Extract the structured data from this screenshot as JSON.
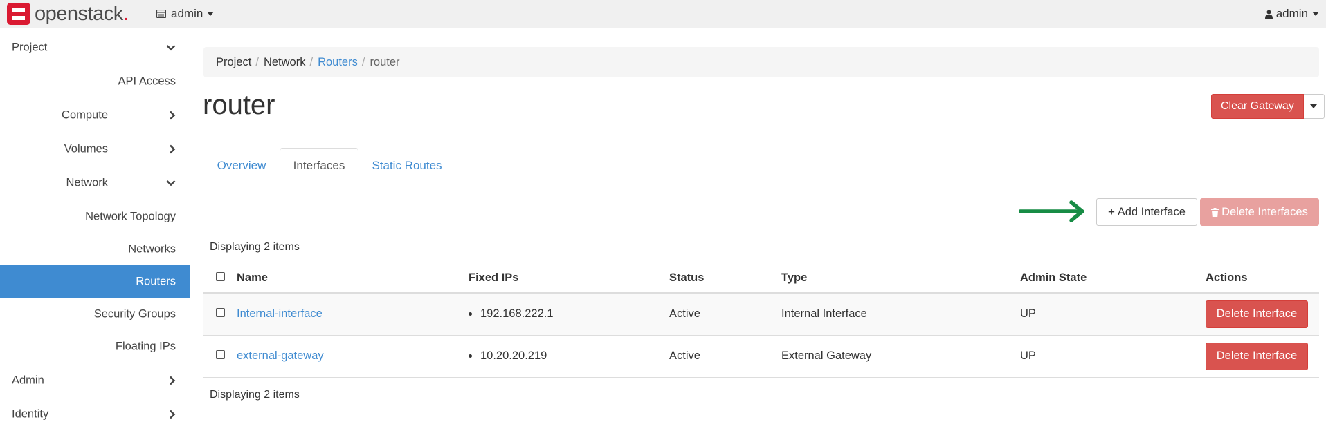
{
  "navbar": {
    "logo_text": "openstack",
    "logo_dot": ".",
    "project": "admin",
    "user": "admin"
  },
  "sidebar": {
    "items": [
      {
        "label": "Project",
        "level": 0,
        "chevron": "down"
      },
      {
        "label": "API Access",
        "level": 2,
        "chevron": ""
      },
      {
        "label": "Compute",
        "level": 1,
        "chevron": "right"
      },
      {
        "label": "Volumes",
        "level": 1,
        "chevron": "right"
      },
      {
        "label": "Network",
        "level": 1,
        "chevron": "down"
      },
      {
        "label": "Network Topology",
        "level": 2,
        "chevron": ""
      },
      {
        "label": "Networks",
        "level": 2,
        "chevron": ""
      },
      {
        "label": "Routers",
        "level": 2,
        "chevron": "",
        "active": true
      },
      {
        "label": "Security Groups",
        "level": 2,
        "chevron": ""
      },
      {
        "label": "Floating IPs",
        "level": 2,
        "chevron": ""
      },
      {
        "label": "Admin",
        "level": 0,
        "chevron": "right"
      },
      {
        "label": "Identity",
        "level": 0,
        "chevron": "right"
      }
    ]
  },
  "breadcrumb": {
    "items": [
      "Project",
      "Network",
      "Routers",
      "router"
    ],
    "separator": "/"
  },
  "page": {
    "title": "router",
    "clear_gateway_label": "Clear Gateway"
  },
  "tabs": [
    {
      "label": "Overview",
      "active": false
    },
    {
      "label": "Interfaces",
      "active": true
    },
    {
      "label": "Static Routes",
      "active": false
    }
  ],
  "actions": {
    "add_interface": "Add Interface",
    "add_interface_icon": "plus-icon",
    "delete_interfaces": "Delete Interfaces",
    "delete_interfaces_icon": "trash-icon"
  },
  "table": {
    "count_top": "Displaying 2 items",
    "count_bottom": "Displaying 2 items",
    "columns": [
      "Name",
      "Fixed IPs",
      "Status",
      "Type",
      "Admin State",
      "Actions"
    ],
    "rows": [
      {
        "name": "Internal-interface",
        "fixed_ip": "192.168.222.1",
        "status": "Active",
        "type": "Internal Interface",
        "admin_state": "UP",
        "action": "Delete Interface"
      },
      {
        "name": "external-gateway",
        "fixed_ip": "10.20.20.219",
        "status": "Active",
        "type": "External Gateway",
        "admin_state": "UP",
        "action": "Delete Interface"
      }
    ]
  },
  "colors": {
    "primary": "#3f8bd1",
    "danger": "#d9534f",
    "danger_disabled": "#e8a19f",
    "brand": "#da1a32",
    "annotation_arrow": "#178c45"
  }
}
